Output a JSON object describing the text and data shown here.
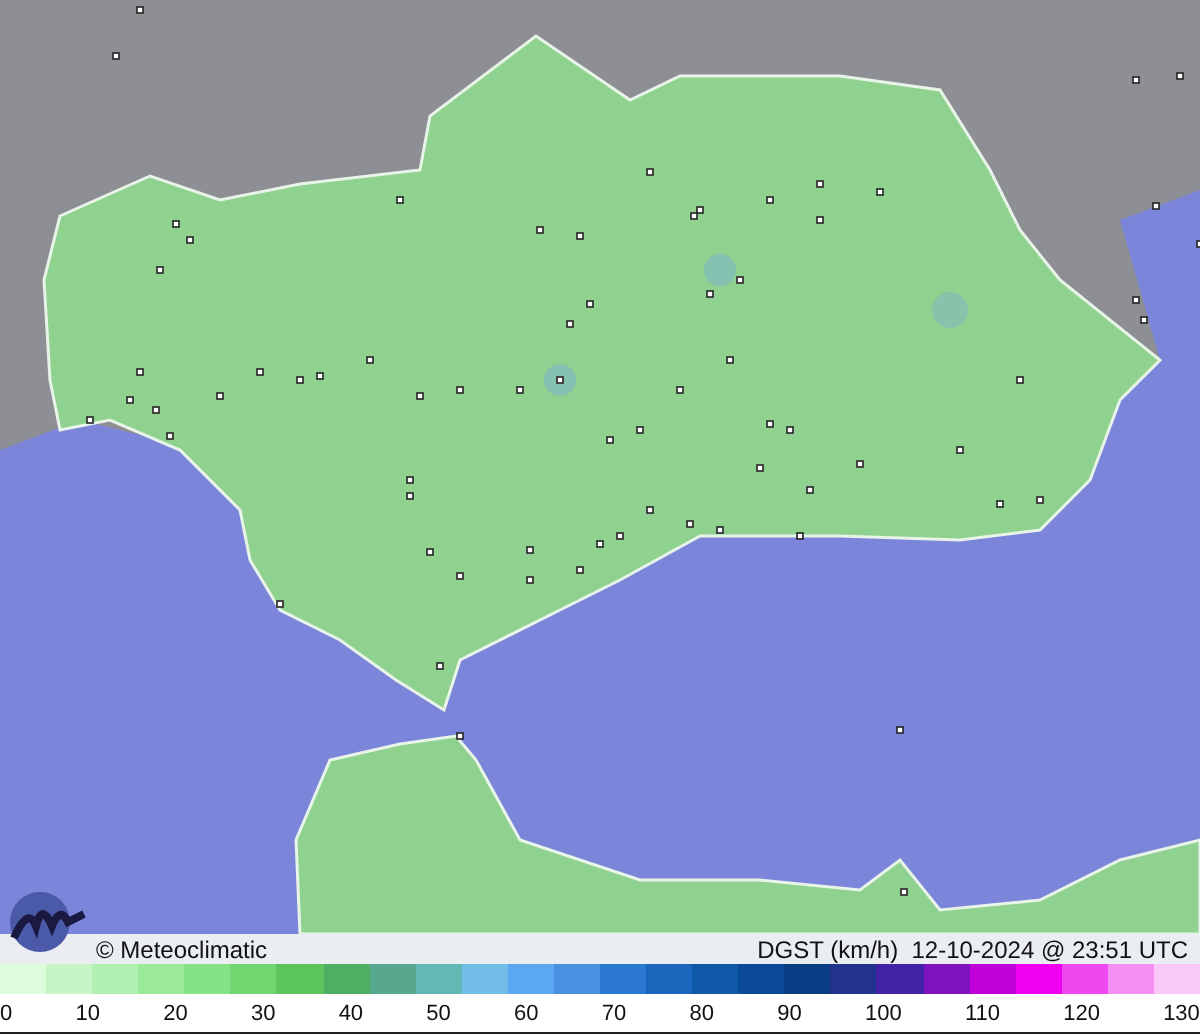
{
  "map": {
    "credit": "© Meteoclimatic",
    "caption": "DGST (km/h)  12-10-2024 @ 23:51 UTC"
  },
  "legend": {
    "swatches": [
      {
        "color": "#dcfcdc"
      },
      {
        "color": "#c6f6c6"
      },
      {
        "color": "#b0f0b0"
      },
      {
        "color": "#9aea9a"
      },
      {
        "color": "#86e286"
      },
      {
        "color": "#70d670"
      },
      {
        "color": "#5cc65c"
      },
      {
        "color": "#4eae62"
      },
      {
        "color": "#58a890"
      },
      {
        "color": "#62b8b4"
      },
      {
        "color": "#72bce8"
      },
      {
        "color": "#5aa8f0"
      },
      {
        "color": "#4890e0"
      },
      {
        "color": "#2a78d0"
      },
      {
        "color": "#1a66bc"
      },
      {
        "color": "#1058a8"
      },
      {
        "color": "#0a4a98"
      },
      {
        "color": "#0a3e84"
      },
      {
        "color": "#22338c"
      },
      {
        "color": "#4422a8"
      },
      {
        "color": "#8012c0"
      },
      {
        "color": "#c000d8"
      },
      {
        "color": "#f000f0"
      },
      {
        "color": "#f048f0"
      },
      {
        "color": "#f490f4"
      },
      {
        "color": "#f9c8f9"
      }
    ],
    "ticks": [
      "0",
      "10",
      "20",
      "30",
      "40",
      "50",
      "60",
      "70",
      "80",
      "90",
      "100",
      "110",
      "120",
      "130"
    ]
  }
}
